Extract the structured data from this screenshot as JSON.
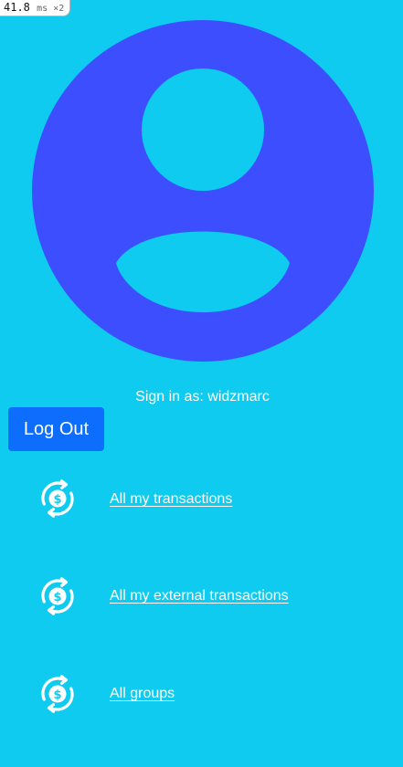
{
  "perf_badge": {
    "value": "41.8",
    "unit": "ms ×2"
  },
  "profile": {
    "avatar_icon": "user-circle-icon",
    "signin_prefix": "Sign in as: ",
    "username": "widzmarc"
  },
  "logout_label": "Log Out",
  "nav": {
    "items": [
      {
        "label": "All my transactions",
        "icon": "exchange-dollar-icon"
      },
      {
        "label": "All my external transactions",
        "icon": "exchange-dollar-icon"
      },
      {
        "label": "All groups",
        "icon": "exchange-dollar-icon"
      }
    ]
  },
  "colors": {
    "background": "#0ecbef",
    "avatar": "#3d4eff",
    "button": "#0d6efd",
    "text": "#ffffff"
  }
}
